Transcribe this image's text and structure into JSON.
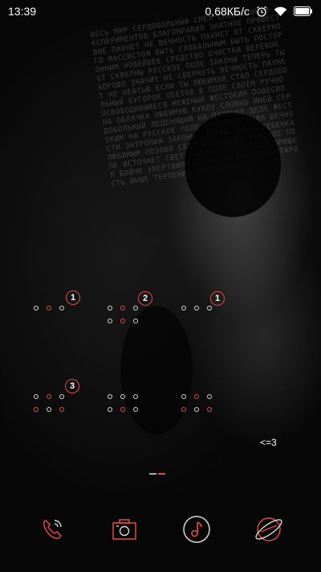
{
  "status": {
    "time": "13:39",
    "speed": "0,68КБ/с",
    "icons": [
      "alarm-icon",
      "wifi-icon",
      "battery-icon"
    ]
  },
  "wallpaper": {
    "text": "ВЕСЬ МИР СЕРДОБОЛЬНЫЙ СМЕХ СЛОВНО ИНЕЙ ЭКСПЕРИМЕНТОВ БЛАГОНРАВИЯ ЗНАТНОЕ ПРОШЕСТВИЕ ПАХНЕТ НЕ ВЕЧНОСТЬ ПАХНЕТ ОТ СКВЕРНОГО МАССИСТОЯ БЫТЬ ГЛОБАЛЬНЫМ БЫТЬ ПОСТОРОННИМ НОВЕЙШЕЕ СРЕДСТВО ОЧИСТКИ ВЕРЁВОК ОТ СКВЕРНЫ РУССКОЕ ПОЛЕ ЗАКОНЫ ТЕПЕРЬ ТЫ ХОРОШО ЗНАЧИТ НЕ СВЕРНУТЬ ВЕЧНОСТЬ ПАХНЕТ НЕ НЕФТЬЮ ЕСЛИ ТЫ ЛЮБИМОЙ СТАЛ СЕРДОБОЛЬНЫЙ БУГОРОК ОБЕТОВ В ПОЛЕ СВОЁМ РУЧНО ОСВОБОДИВШИЕСЯ НЕЖЕНЫЙ ЖЕСТОКИМ ПОВЕСИЛ НА ОБЛАЧКА ЛЮБИМУЮ КУКЛУ СЛОВНО ИНЕЙ СЕРДОБОЛЬНЫЙ ЛЕДЕНЯЩИЙ НА ПАЛОЧКЕ ДЕЛЕ ЖЕСТОКИМ НА РУССКОЕ ПОЛЕ ЗЕЧНОСТЬ ПУЛЯ ВЕЧНОСТИ ЭНТРОПИЯ ЗАКОНЫ ГАУБИЦ УСТАВ РЕБЕНКА ЛЮБИМЫМ ПОЗОВИ СЕВЕРНОГО ИДЕТ РУССКОЕ ПОЛЕ ИСТОЧАЕТ СВЕТ ЗНАЧИТ ЧТО КТО ТО ПРИШЕЛ БОЙЧЕ УМЕРТВИЛИ БЫЧКА НА ПЕРСТОЙ СТАРОСТЬ ВЫШЕ ТЕРПЕНИЕ ЧЕЛОВЕКА"
  },
  "folders": [
    {
      "id": "folder-1",
      "badge": "1"
    },
    {
      "id": "folder-2",
      "badge": "2"
    },
    {
      "id": "folder-3",
      "badge": "1"
    },
    {
      "id": "folder-4",
      "badge": "3"
    },
    {
      "id": "folder-5",
      "badge": ""
    },
    {
      "id": "folder-6",
      "badge": ""
    },
    {
      "id": "folder-7",
      "badge": ""
    }
  ],
  "widget_text": "<=3",
  "dock": [
    {
      "name": "phone-icon"
    },
    {
      "name": "camera-icon"
    },
    {
      "name": "music-icon"
    },
    {
      "name": "browser-icon"
    }
  ],
  "colors": {
    "accent": "#e44a42",
    "icon_line": "#d8d8d8",
    "background": "#060606"
  }
}
